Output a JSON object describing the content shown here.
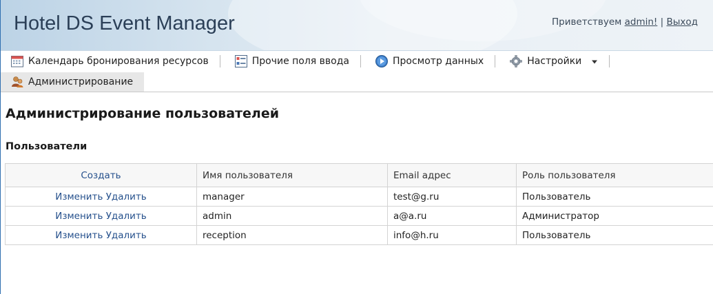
{
  "app": {
    "title": "Hotel DS Event Manager",
    "greeting": "Приветствуем",
    "username": "admin!",
    "separator": "|",
    "logout": "Выход"
  },
  "menu": {
    "items": [
      {
        "label": "Календарь бронирования ресурсов",
        "icon": "calendar-icon"
      },
      {
        "label": "Прочие поля ввода",
        "icon": "form-fields-icon"
      },
      {
        "label": "Просмотр данных",
        "icon": "play-circle-icon"
      },
      {
        "label": "Настройки",
        "icon": "gear-icon"
      },
      {
        "label": "Администрирование",
        "icon": "admin-users-icon"
      }
    ],
    "dropdown_icon": "triangle-down-icon"
  },
  "page": {
    "title": "Администрирование пользователей",
    "section": "Пользователи"
  },
  "table": {
    "headers": {
      "create": "Создать",
      "username": "Имя пользователя",
      "email": "Email адрес",
      "role": "Роль пользователя"
    },
    "rows": [
      {
        "edit": "Изменить",
        "delete": "Удалить",
        "username": "manager",
        "email": "test@g.ru",
        "role": "Пользователь"
      },
      {
        "edit": "Изменить",
        "delete": "Удалить",
        "username": "admin",
        "email": "a@a.ru",
        "role": "Администратор"
      },
      {
        "edit": "Изменить",
        "delete": "Удалить",
        "username": "reception",
        "email": "info@h.ru",
        "role": "Пользователь"
      }
    ]
  },
  "colors": {
    "link": "#25508c",
    "title": "#2b3f57",
    "header_bg_start": "#bcd3e6"
  }
}
